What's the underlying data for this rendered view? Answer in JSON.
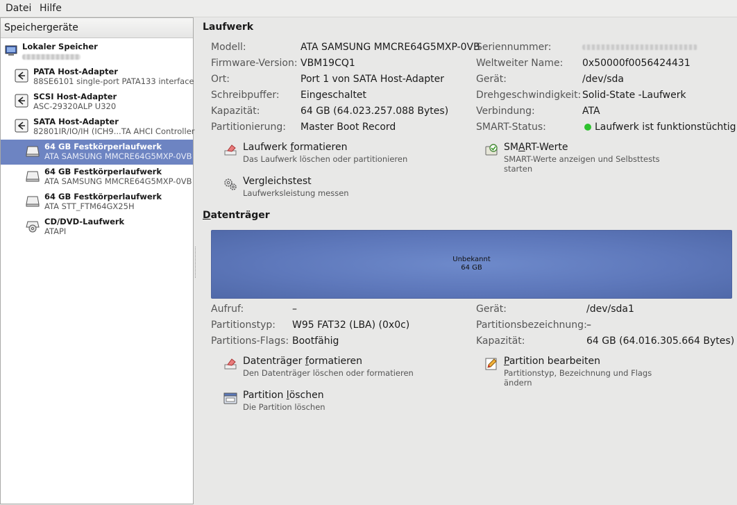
{
  "menu": {
    "file": "Datei",
    "help": "Hilfe"
  },
  "sidebar": {
    "header": "Speichergeräte",
    "items": [
      {
        "title": "Lokaler Speicher",
        "subtitle": "",
        "icon": "computer-icon"
      },
      {
        "title": "PATA Host-Adapter",
        "subtitle": "88SE6101 single-port PATA133 interface",
        "icon": "host-adapter-icon"
      },
      {
        "title": "SCSI Host-Adapter",
        "subtitle": "ASC-29320ALP U320",
        "icon": "host-adapter-icon"
      },
      {
        "title": "SATA Host-Adapter",
        "subtitle": "82801IR/IO/IH (ICH9...TA AHCI Controller",
        "icon": "host-adapter-icon"
      },
      {
        "title": "64 GB Festkörperlaufwerk",
        "subtitle": "ATA SAMSUNG MMCRE64G5MXP-0VB",
        "icon": "drive-icon",
        "selected": true
      },
      {
        "title": "64 GB Festkörperlaufwerk",
        "subtitle": "ATA SAMSUNG MMCRE64G5MXP-0VB",
        "icon": "drive-icon"
      },
      {
        "title": "64 GB Festkörperlaufwerk",
        "subtitle": "ATA STT_FTM64GX25H",
        "icon": "drive-icon"
      },
      {
        "title": "CD/DVD-Laufwerk",
        "subtitle": "ATAPI",
        "icon": "optical-drive-icon"
      }
    ]
  },
  "drive": {
    "title": "Laufwerk",
    "left": [
      {
        "label": "Modell:",
        "value": "ATA SAMSUNG MMCRE64G5MXP-0VB"
      },
      {
        "label": "Firmware-Version:",
        "value": "VBM19CQ1"
      },
      {
        "label": "Ort:",
        "value": "Port 1 von SATA Host-Adapter"
      },
      {
        "label": "Schreibpuffer:",
        "value": "Eingeschaltet"
      },
      {
        "label": "Kapazität:",
        "value": "64 GB (64.023.257.088 Bytes)"
      },
      {
        "label": "Partitionierung:",
        "value": "Master Boot Record"
      }
    ],
    "right": [
      {
        "label": "Seriennummer:",
        "value": ""
      },
      {
        "label": "Weltweiter Name:",
        "value": "0x50000f0056424431"
      },
      {
        "label": "Gerät:",
        "value": "/dev/sda"
      },
      {
        "label": "Drehgeschwindigkeit:",
        "value": "Solid-State -Laufwerk"
      },
      {
        "label": "Verbindung:",
        "value": "ATA"
      },
      {
        "label": "SMART-Status:",
        "value": "Laufwerk ist funktionstüchtig"
      }
    ],
    "actions": {
      "format": {
        "title_pre": "Laufwerk ",
        "title_key": "f",
        "title_post": "ormatieren",
        "sub": "Das Laufwerk löschen oder partitionieren"
      },
      "smart": {
        "title_pre": "SM",
        "title_key": "A",
        "title_post": "RT-Werte",
        "sub1": "SMART-Werte anzeigen und Selbsttests",
        "sub2": "starten"
      },
      "benchmark": {
        "title": "Vergleichstest",
        "sub": "Laufwerksleistung messen"
      }
    }
  },
  "volumes": {
    "title_key": "D",
    "title_rest": "atenträger",
    "bar": {
      "name": "Unbekannt",
      "size": "64 GB"
    },
    "left": [
      {
        "label": "Aufruf:",
        "value": "–"
      },
      {
        "label": "Partitionstyp:",
        "value": "W95 FAT32 (LBA) (0x0c)"
      },
      {
        "label": "Partitions-Flags:",
        "value": "Bootfähig"
      }
    ],
    "right": [
      {
        "label": "Gerät:",
        "value": "/dev/sda1"
      },
      {
        "label": "Partitionsbezeichnung:",
        "value": "–"
      },
      {
        "label": "Kapazität:",
        "value": "64 GB (64.016.305.664 Bytes)"
      }
    ],
    "actions": {
      "format": {
        "title_pre": "Datenträger ",
        "title_key": "f",
        "title_post": "ormatieren",
        "sub": "Den Datenträger löschen oder formatieren"
      },
      "edit": {
        "title_pre": "",
        "title_key": "P",
        "title_post": "artition bearbeiten",
        "sub1": "Partitionstyp, Bezeichnung und Flags",
        "sub2": "ändern"
      },
      "delete": {
        "title_pre": "Partition ",
        "title_key": "l",
        "title_post": "öschen",
        "sub": "Die Partition löschen"
      }
    }
  },
  "colors": {
    "selection": "#6d84c2",
    "smart_ok": "#2ec22e",
    "disk_bar": "#5e78bb"
  }
}
